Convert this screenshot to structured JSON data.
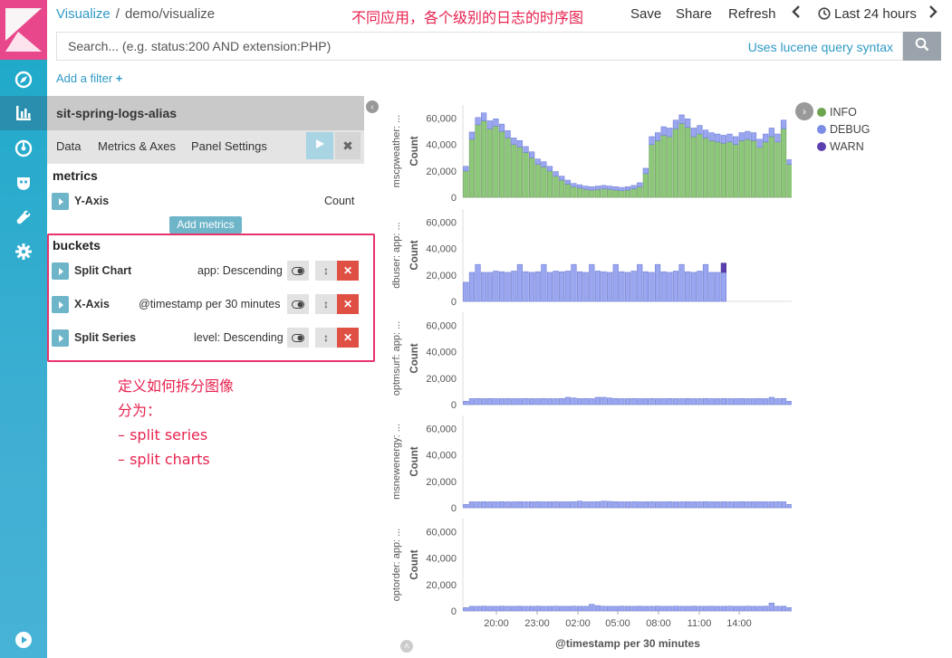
{
  "breadcrumb": {
    "root": "Visualize",
    "separator": "/",
    "current": "demo/visualize"
  },
  "annotation_top": "不同应用，各个级别的日志的时序图",
  "menu": {
    "save": "Save",
    "share": "Share",
    "refresh": "Refresh",
    "time_range": "Last 24 hours"
  },
  "search": {
    "placeholder": "Search... (e.g. status:200 AND extension:PHP)",
    "lucene_link": "Uses lucene query syntax"
  },
  "add_filter": "Add a filter",
  "editor": {
    "index_pattern": "sit-spring-logs-alias",
    "tabs": [
      "Data",
      "Metrics & Axes",
      "Panel Settings"
    ],
    "metrics_title": "metrics",
    "metric": {
      "title": "Y-Axis",
      "desc": "Count"
    },
    "add_metrics": "Add metrics",
    "buckets_title": "buckets",
    "buckets": [
      {
        "title": "Split Chart",
        "desc": "app: Descending"
      },
      {
        "title": "X-Axis",
        "desc": "@timestamp per 30 minutes"
      },
      {
        "title": "Split Series",
        "desc": "level: Descending"
      }
    ]
  },
  "annotation_buckets": [
    "定义如何拆分图像",
    "分为：",
    "– split series",
    "– split charts"
  ],
  "legend": [
    {
      "name": "INFO",
      "color": "#6ca44f"
    },
    {
      "name": "DEBUG",
      "color": "#7b8de6"
    },
    {
      "name": "WARN",
      "color": "#5b3fb1"
    }
  ],
  "colors": {
    "info": "#8dc77a",
    "debug": "#9aa6ef",
    "accent": "#2f9ac6"
  },
  "chart_data": {
    "type": "bar",
    "stacked": true,
    "xlabel": "@timestamp per 30 minutes",
    "ylabel": "Count",
    "ylim": [
      0,
      70000
    ],
    "yticks": [
      "0",
      "20,000",
      "40,000",
      "60,000"
    ],
    "xticks": [
      "20:00",
      "23:00",
      "02:00",
      "05:00",
      "08:00",
      "11:00",
      "14:00"
    ],
    "panels": [
      {
        "label": "mscpweather: ...",
        "series": [
          {
            "name": "INFO",
            "values": [
              20000,
              44000,
              55000,
              58000,
              52000,
              54000,
              50000,
              45000,
              40000,
              38000,
              34000,
              30000,
              25000,
              23000,
              20000,
              16000,
              13000,
              10000,
              8000,
              7000,
              6000,
              5500,
              6000,
              6500,
              6000,
              5500,
              5000,
              5500,
              6500,
              8000,
              18000,
              40000,
              43000,
              47000,
              46000,
              52000,
              56000,
              53000,
              46000,
              48000,
              45000,
              43000,
              42000,
              41000,
              42000,
              40000,
              43000,
              44000,
              43000,
              38000,
              42000,
              46000,
              42000,
              52000,
              25000
            ]
          },
          {
            "name": "DEBUG",
            "values": [
              3500,
              5500,
              5500,
              6000,
              6000,
              5500,
              5500,
              5500,
              5000,
              5000,
              4500,
              4500,
              4000,
              4000,
              3500,
              3500,
              3000,
              3000,
              2500,
              2500,
              2500,
              2500,
              2500,
              2500,
              2500,
              2500,
              2500,
              2500,
              2500,
              3000,
              4000,
              6000,
              6000,
              6500,
              6500,
              6500,
              6500,
              6500,
              6500,
              6500,
              6000,
              6000,
              6000,
              6000,
              6000,
              6000,
              6000,
              6000,
              6000,
              6000,
              6000,
              6500,
              6000,
              6500,
              3500
            ]
          },
          {
            "name": "WARN",
            "values": [
              0,
              0,
              0,
              0,
              0,
              0,
              0,
              0,
              0,
              0,
              0,
              0,
              0,
              0,
              0,
              0,
              0,
              0,
              0,
              0,
              0,
              0,
              0,
              0,
              0,
              0,
              0,
              0,
              0,
              0,
              0,
              0,
              0,
              0,
              0,
              0,
              0,
              0,
              0,
              0,
              0,
              0,
              0,
              0,
              0,
              0,
              0,
              0,
              0,
              0,
              0,
              0,
              0,
              0,
              0
            ]
          }
        ]
      },
      {
        "label": "dbuser: app: ...",
        "series": [
          {
            "name": "INFO",
            "values": [
              0,
              0,
              0,
              0,
              0,
              0,
              0,
              0,
              0,
              0,
              0,
              0,
              0,
              0,
              0,
              0,
              0,
              0,
              0,
              0,
              0,
              0,
              0,
              0,
              0,
              0,
              0,
              0,
              0,
              0,
              0,
              0,
              0,
              0,
              0,
              0,
              0,
              0,
              0,
              0,
              0,
              0,
              0,
              0,
              0,
              0,
              0,
              0,
              0,
              0,
              0,
              0,
              0,
              0,
              0
            ]
          },
          {
            "name": "DEBUG",
            "values": [
              14500,
              22000,
              28000,
              22000,
              22000,
              23000,
              22500,
              22000,
              23000,
              28000,
              22500,
              22000,
              22500,
              28000,
              22000,
              23000,
              22500,
              23000,
              28000,
              22500,
              22000,
              28000,
              23000,
              22500,
              22000,
              28000,
              22500,
              22000,
              23000,
              28000,
              22500,
              22000,
              28000,
              22500,
              22000,
              23000,
              28000,
              22500,
              22000,
              23000,
              28000,
              22000,
              22000,
              22000,
              0,
              0,
              0,
              0,
              0,
              0,
              0,
              0,
              0,
              0,
              0
            ]
          },
          {
            "name": "WARN",
            "values": [
              0,
              0,
              0,
              0,
              0,
              0,
              0,
              0,
              0,
              0,
              0,
              0,
              0,
              0,
              0,
              0,
              0,
              0,
              0,
              0,
              0,
              0,
              0,
              0,
              0,
              0,
              0,
              0,
              0,
              0,
              0,
              0,
              0,
              0,
              0,
              0,
              0,
              0,
              0,
              0,
              0,
              0,
              0,
              7000,
              0,
              0,
              0,
              0,
              0,
              0,
              0,
              0,
              0,
              0,
              0
            ]
          }
        ]
      },
      {
        "label": "optmsurf: app: ...",
        "series": [
          {
            "name": "INFO",
            "values": [
              0,
              0,
              0,
              0,
              0,
              0,
              0,
              0,
              0,
              0,
              0,
              0,
              0,
              0,
              0,
              0,
              0,
              0,
              0,
              0,
              0,
              0,
              0,
              0,
              0,
              0,
              0,
              0,
              0,
              0,
              0,
              0,
              0,
              0,
              0,
              0,
              0,
              0,
              0,
              0,
              0,
              0,
              0,
              0,
              0,
              0,
              0,
              0,
              0,
              0,
              0,
              0,
              0,
              0,
              0
            ]
          },
          {
            "name": "DEBUG",
            "values": [
              2500,
              4500,
              4600,
              4500,
              4600,
              4500,
              4500,
              4600,
              4500,
              4500,
              4600,
              4500,
              4500,
              4600,
              4500,
              4500,
              4600,
              5500,
              5000,
              4500,
              4600,
              4500,
              5500,
              5500,
              5000,
              4600,
              4500,
              4500,
              4600,
              4500,
              4500,
              4600,
              4500,
              4500,
              4600,
              4500,
              4500,
              4600,
              4500,
              4500,
              4600,
              4500,
              4500,
              4600,
              4500,
              4500,
              4600,
              4500,
              4500,
              4600,
              4500,
              5500,
              4500,
              4600,
              2500
            ]
          },
          {
            "name": "WARN",
            "values": [
              0,
              0,
              0,
              0,
              0,
              0,
              0,
              0,
              0,
              0,
              0,
              0,
              0,
              0,
              0,
              0,
              0,
              0,
              0,
              0,
              0,
              0,
              0,
              0,
              0,
              0,
              0,
              0,
              0,
              0,
              0,
              0,
              0,
              0,
              0,
              0,
              0,
              0,
              0,
              0,
              0,
              0,
              0,
              0,
              0,
              0,
              0,
              0,
              0,
              0,
              0,
              0,
              0,
              0,
              0
            ]
          }
        ]
      },
      {
        "label": "msnewenergy: ...",
        "series": [
          {
            "name": "INFO",
            "values": [
              0,
              0,
              0,
              0,
              0,
              0,
              0,
              0,
              0,
              0,
              0,
              0,
              0,
              0,
              0,
              0,
              0,
              0,
              0,
              0,
              0,
              0,
              0,
              0,
              0,
              0,
              0,
              0,
              0,
              0,
              0,
              0,
              0,
              0,
              0,
              0,
              0,
              0,
              0,
              0,
              0,
              0,
              0,
              0,
              0,
              0,
              0,
              0,
              0,
              0,
              0,
              0,
              0,
              0,
              0
            ]
          },
          {
            "name": "DEBUG",
            "values": [
              2500,
              4500,
              4500,
              4600,
              4500,
              4500,
              4600,
              4500,
              4500,
              4600,
              4500,
              4500,
              4600,
              4500,
              4500,
              4600,
              4500,
              4500,
              4600,
              5000,
              4500,
              4500,
              4600,
              5000,
              4800,
              4600,
              4500,
              4500,
              4600,
              4500,
              4500,
              4600,
              4500,
              4500,
              4600,
              4500,
              4500,
              4600,
              4500,
              4500,
              4600,
              4500,
              4500,
              4600,
              4500,
              4500,
              4600,
              4500,
              4500,
              4600,
              4500,
              4500,
              4600,
              4500,
              2500
            ]
          },
          {
            "name": "WARN",
            "values": [
              0,
              0,
              0,
              0,
              0,
              0,
              0,
              0,
              0,
              0,
              0,
              0,
              0,
              0,
              0,
              0,
              0,
              0,
              0,
              0,
              0,
              0,
              0,
              0,
              0,
              0,
              0,
              0,
              0,
              0,
              0,
              0,
              0,
              0,
              0,
              0,
              0,
              0,
              0,
              0,
              0,
              0,
              0,
              0,
              0,
              0,
              0,
              0,
              0,
              0,
              0,
              0,
              0,
              0,
              0
            ]
          }
        ]
      },
      {
        "label": "optorder: app: ...",
        "series": [
          {
            "name": "INFO",
            "values": [
              0,
              0,
              0,
              0,
              0,
              0,
              0,
              0,
              0,
              0,
              0,
              0,
              0,
              0,
              0,
              0,
              0,
              0,
              0,
              0,
              0,
              0,
              0,
              0,
              0,
              0,
              0,
              0,
              0,
              0,
              0,
              0,
              0,
              0,
              0,
              0,
              0,
              0,
              0,
              0,
              0,
              0,
              0,
              0,
              0,
              0,
              0,
              0,
              0,
              0,
              0,
              0,
              0,
              0,
              0
            ]
          },
          {
            "name": "DEBUG",
            "values": [
              2500,
              3500,
              3500,
              3600,
              3500,
              3500,
              3600,
              3500,
              3500,
              3600,
              3500,
              3500,
              3600,
              3500,
              3500,
              3600,
              3500,
              3500,
              3600,
              3500,
              3500,
              5000,
              4000,
              3600,
              3500,
              3500,
              3600,
              3500,
              3500,
              3600,
              3500,
              3500,
              3600,
              3500,
              3500,
              3600,
              3500,
              3500,
              3600,
              3500,
              3500,
              3600,
              3500,
              3500,
              3600,
              3500,
              3500,
              3600,
              3500,
              3500,
              3600,
              6000,
              3500,
              3600,
              2500
            ]
          },
          {
            "name": "WARN",
            "values": [
              0,
              0,
              0,
              0,
              0,
              0,
              0,
              0,
              0,
              0,
              0,
              0,
              0,
              0,
              0,
              0,
              0,
              0,
              0,
              0,
              0,
              0,
              0,
              0,
              0,
              0,
              0,
              0,
              0,
              0,
              0,
              0,
              0,
              0,
              0,
              0,
              0,
              0,
              0,
              0,
              0,
              0,
              0,
              0,
              0,
              0,
              0,
              0,
              0,
              0,
              0,
              0,
              0,
              0,
              0
            ]
          }
        ]
      }
    ]
  }
}
